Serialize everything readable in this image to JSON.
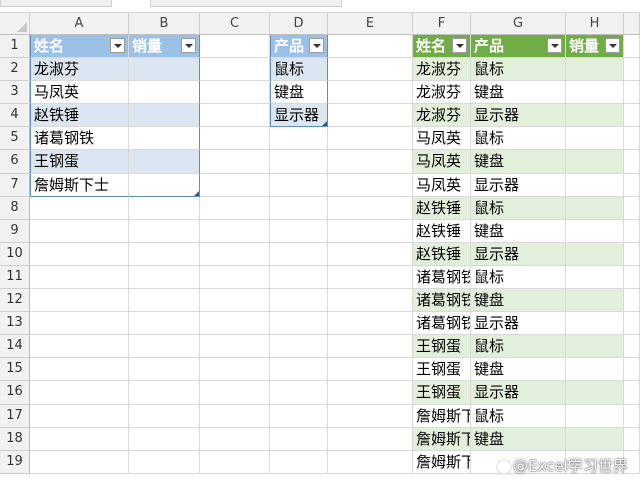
{
  "columns": [
    "A",
    "B",
    "C",
    "D",
    "E",
    "F",
    "G",
    "H"
  ],
  "rows": [
    "1",
    "2",
    "3",
    "4",
    "5",
    "6",
    "7",
    "8",
    "9",
    "10",
    "11",
    "12",
    "13",
    "14",
    "15",
    "16",
    "17",
    "18",
    "19"
  ],
  "table1": {
    "headers": [
      "姓名",
      "销量"
    ],
    "names": [
      "龙淑芬",
      "马凤英",
      "赵铁锤",
      "诸葛钢铁",
      "王钢蛋",
      "詹姆斯下士"
    ]
  },
  "table2": {
    "header": "产品",
    "items": [
      "鼠标",
      "键盘",
      "显示器"
    ]
  },
  "table3": {
    "headers": [
      "姓名",
      "产品",
      "销量"
    ],
    "rows": [
      [
        "龙淑芬",
        "鼠标"
      ],
      [
        "龙淑芬",
        "键盘"
      ],
      [
        "龙淑芬",
        "显示器"
      ],
      [
        "马凤英",
        "鼠标"
      ],
      [
        "马凤英",
        "键盘"
      ],
      [
        "马凤英",
        "显示器"
      ],
      [
        "赵铁锤",
        "鼠标"
      ],
      [
        "赵铁锤",
        "键盘"
      ],
      [
        "赵铁锤",
        "显示器"
      ],
      [
        "诸葛钢铁",
        "鼠标"
      ],
      [
        "诸葛钢铁",
        "键盘"
      ],
      [
        "诸葛钢铁",
        "显示器"
      ],
      [
        "王钢蛋",
        "鼠标"
      ],
      [
        "王钢蛋",
        "键盘"
      ],
      [
        "王钢蛋",
        "显示器"
      ],
      [
        "詹姆斯下士",
        "鼠标"
      ],
      [
        "詹姆斯下士",
        "键盘"
      ]
    ],
    "partial_row": [
      "詹姆斯下士"
    ]
  },
  "watermark": "@Excel学习世界",
  "colors": {
    "blue_header": "#9bc2e6",
    "blue_band": "#dce6f1",
    "green_header": "#70ad47",
    "green_band": "#e2efda",
    "grid": "#d9d9d9"
  }
}
